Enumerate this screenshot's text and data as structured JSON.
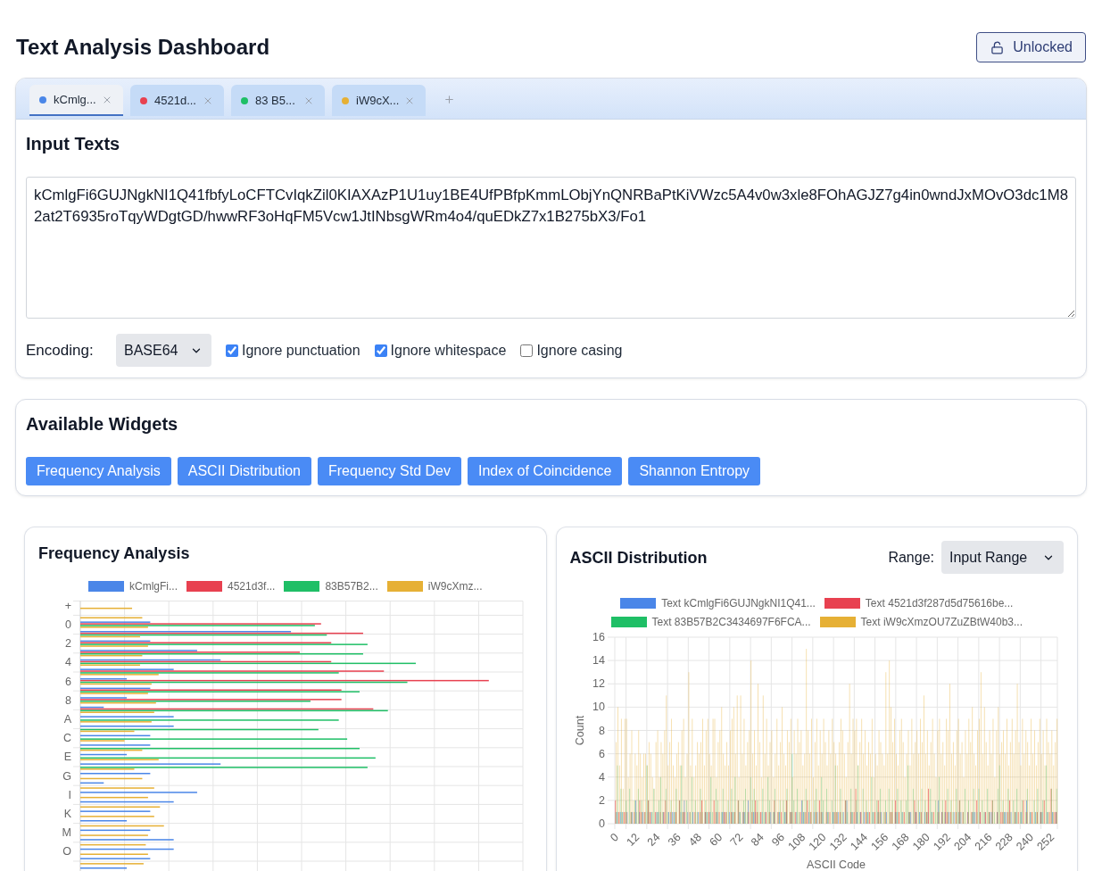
{
  "header": {
    "title": "Text Analysis Dashboard",
    "lock_button": {
      "label": "Unlocked",
      "locked": false
    }
  },
  "text_tabs": [
    {
      "label": "kCmlg...",
      "color": "#4a86e8",
      "selected": true
    },
    {
      "label": "4521d...",
      "color": "#e84150",
      "selected": false
    },
    {
      "label": "83 B5...",
      "color": "#1fbf66",
      "selected": false
    },
    {
      "label": "iW9cX...",
      "color": "#e6b035",
      "selected": false
    }
  ],
  "input_panel": {
    "title": "Input Texts",
    "text": "kCmlgFi6GUJNgkNI1Q41fbfyLoCFTCvIqkZil0KIAXAzP1U1uy1BE4UfPBfpKmmLObjYnQNRBaPtKiVWzc5A4v0w3xle8FOhAGJZ7g4in0wndJxMOvO3dc1M82at2T6935roTqyWDgtGD/hwwRF3oHqFM5Vcw1JtINbsgWRm4o4/quEDkZ7x1B275bX3/Fo1",
    "encoding": {
      "label": "Encoding:",
      "value": "BASE64"
    },
    "options": [
      {
        "label": "Ignore punctuation",
        "checked": true
      },
      {
        "label": "Ignore whitespace",
        "checked": true
      },
      {
        "label": "Ignore casing",
        "checked": false
      }
    ]
  },
  "widgets_panel": {
    "title": "Available Widgets",
    "buttons": [
      "Frequency Analysis",
      "ASCII Distribution",
      "Frequency Std Dev",
      "Index of Coincidence",
      "Shannon Entropy"
    ]
  },
  "frequency_widget": {
    "title": "Frequency Analysis",
    "legend": [
      {
        "label": "kCmlgFi...",
        "color": "#4a86e8"
      },
      {
        "label": "4521d3f...",
        "color": "#e84150"
      },
      {
        "label": "83B57B2...",
        "color": "#1fbf66"
      },
      {
        "label": "iW9cXmz...",
        "color": "#e6b035"
      }
    ],
    "axis_labels": [
      "+",
      "0",
      "2",
      "4",
      "6",
      "8",
      "A",
      "C",
      "E",
      "G",
      "I",
      "K",
      "M",
      "O"
    ]
  },
  "ascii_widget": {
    "title": "ASCII Distribution",
    "range": {
      "label": "Range:",
      "value": "Input Range"
    },
    "legend": [
      {
        "label": "Text kCmlgFi6GUJNgkNI1Q41...",
        "color": "#4a86e8"
      },
      {
        "label": "Text 4521d3f287d5d75616be...",
        "color": "#e84150"
      },
      {
        "label": "Text 83B57B2C3434697F6FCA...",
        "color": "#1fbf66"
      },
      {
        "label": "Text iW9cXmzOU7ZuZBtW40b3...",
        "color": "#e6b035"
      }
    ],
    "y_title": "Count",
    "x_title": "ASCII Code",
    "y_ticks": [
      "16",
      "14",
      "12",
      "10",
      "8",
      "6",
      "4",
      "2",
      "0"
    ],
    "x_ticks": [
      "0",
      "12",
      "24",
      "36",
      "48",
      "60",
      "72",
      "84",
      "96",
      "108",
      "120",
      "132",
      "144",
      "156",
      "168",
      "180",
      "192",
      "204",
      "216",
      "228",
      "240",
      "252"
    ]
  }
}
